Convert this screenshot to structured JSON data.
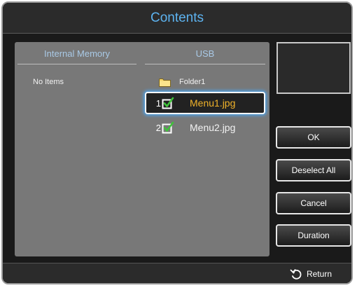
{
  "dialog": {
    "title": "Contents"
  },
  "columns": {
    "internal_header": "Internal Memory",
    "usb_header": "USB"
  },
  "internal": {
    "empty_text": "No Items"
  },
  "usb": {
    "folder": {
      "label": "Folder1",
      "icon": "folder-icon"
    },
    "files": [
      {
        "index": "1",
        "name": "Menu1.jpg",
        "checked": true,
        "selected": true
      },
      {
        "index": "2",
        "name": "Menu2.jpg",
        "checked": true,
        "selected": false
      }
    ]
  },
  "buttons": {
    "ok": "OK",
    "deselect_all": "Deselect All",
    "cancel": "Cancel",
    "duration": "Duration"
  },
  "footer": {
    "return_label": "Return",
    "return_icon": "return-icon"
  },
  "colors": {
    "title": "#5db3f0",
    "selected_text": "#f0b22a",
    "focus_glow": "#4ea2e8",
    "check": "#3fc33a"
  }
}
